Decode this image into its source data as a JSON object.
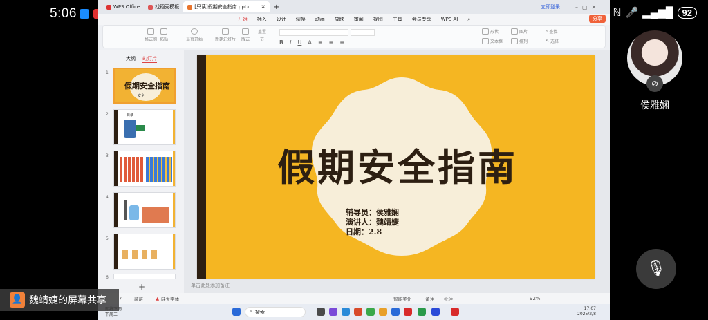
{
  "phone": {
    "time": "5:06",
    "battery": "92",
    "presenter_name": "侯雅娴",
    "share_label": "魏靖婕的屏幕共享"
  },
  "wps": {
    "tabs": [
      {
        "label": "WPS Office"
      },
      {
        "label": "找稻壳模板"
      },
      {
        "label": "[只读]假期安全指南.pptx"
      }
    ],
    "login": "立即登录",
    "ribbon_tabs": [
      "开始",
      "插入",
      "设计",
      "切换",
      "动画",
      "放映",
      "审阅",
      "视图",
      "工具",
      "会员专享",
      "WPS AI"
    ],
    "share_btn": "分享",
    "ribbon_buttons": [
      "格式刷",
      "粘贴",
      "当页开始",
      "新建幻灯片",
      "版式",
      "重置",
      "节",
      "形状",
      "图片",
      "文本框",
      "排列",
      "查找",
      "选择"
    ],
    "view_tabs": [
      "大纲",
      "幻灯片"
    ],
    "slide_numbers": [
      "1",
      "2",
      "3",
      "4",
      "5",
      "6"
    ],
    "thumb1_title": "假期安全指南",
    "thumb1_sub": "安全",
    "thumb2_title": "目录",
    "notes_placeholder": "单击此处添加备注",
    "slide": {
      "title": "假期安全指南",
      "counselor": "辅导员：侯雅娴",
      "speaker": "演讲人：魏靖婕",
      "date": "日期：2.8"
    },
    "status": {
      "page": "7",
      "theme": "蔽蔽",
      "missing_font": "缺失字体",
      "smart_beautify": "智能美化",
      "notes": "备注",
      "comments": "批注",
      "zoom": "92%"
    },
    "taskbar": {
      "weather_line1": "即将下雨",
      "weather_line2": "下周三",
      "search": "搜索",
      "clock_time": "17:07",
      "clock_date": "2025/2/8"
    }
  }
}
